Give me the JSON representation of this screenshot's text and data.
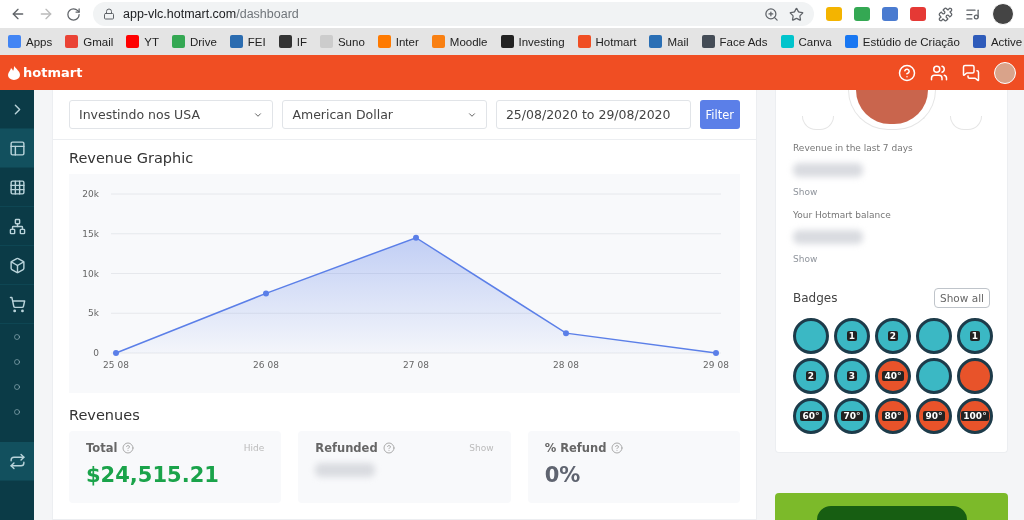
{
  "browser": {
    "url_host": "app-vlc.hotmart.com",
    "url_path": "/dashboard"
  },
  "bookmarks": [
    {
      "label": "Apps",
      "color": "#4285f4"
    },
    {
      "label": "Gmail",
      "color": "#ea4335"
    },
    {
      "label": "YT",
      "color": "#ff0000"
    },
    {
      "label": "Drive",
      "color": "#34a853"
    },
    {
      "label": "FEI",
      "color": "#2b6cb0"
    },
    {
      "label": "IF",
      "color": "#333333"
    },
    {
      "label": "Suno",
      "color": "#cccccc"
    },
    {
      "label": "Inter",
      "color": "#ff7a00"
    },
    {
      "label": "Moodle",
      "color": "#f98012"
    },
    {
      "label": "Investing",
      "color": "#222222"
    },
    {
      "label": "Hotmart",
      "color": "#f04e23"
    },
    {
      "label": "Mail",
      "color": "#2a6fb5"
    },
    {
      "label": "Face Ads",
      "color": "#444c56"
    },
    {
      "label": "Canva",
      "color": "#00c4cc"
    },
    {
      "label": "Estúdio de Criação",
      "color": "#1877f2"
    },
    {
      "label": "Active",
      "color": "#2e5bba"
    }
  ],
  "header": {
    "logo": "hotmart"
  },
  "sidebar": {
    "items": [
      {
        "kind": "chevron",
        "selected": false
      },
      {
        "kind": "dashboard",
        "selected": true
      },
      {
        "kind": "grid",
        "selected": false
      },
      {
        "kind": "network",
        "selected": false
      },
      {
        "kind": "box",
        "selected": false
      },
      {
        "kind": "cart",
        "selected": false
      },
      {
        "kind": "dot",
        "selected": false
      },
      {
        "kind": "dot",
        "selected": false
      },
      {
        "kind": "dot",
        "selected": false
      },
      {
        "kind": "dot",
        "selected": false
      },
      {
        "kind": "sync",
        "selected": true
      }
    ]
  },
  "filters": {
    "product": "Investindo nos USA",
    "currency": "American Dollar",
    "date_range": "25/08/2020 to 29/08/2020",
    "button": "Filter"
  },
  "revenue_graphic": {
    "title": "Revenue Graphic",
    "chart_data": {
      "type": "area",
      "categories": [
        "25 08",
        "26 08",
        "27 08",
        "28 08",
        "29 08"
      ],
      "grid": true,
      "series": [
        {
          "color": "#5b7fe8",
          "values": [
            0,
            7500,
            14500,
            2500,
            0
          ]
        }
      ],
      "ylim": [
        0,
        20000
      ],
      "yticks": [
        {
          "value": 0,
          "label": "0"
        },
        {
          "value": 5000,
          "label": "5k"
        },
        {
          "value": 10000,
          "label": "10k"
        },
        {
          "value": 15000,
          "label": "15k"
        },
        {
          "value": 20000,
          "label": "20k"
        }
      ]
    }
  },
  "revenues": {
    "title": "Revenues",
    "cards": [
      {
        "label": "Total",
        "action": "Hide",
        "hidden": false,
        "value": "$24,515.21",
        "color": "#1aa34a"
      },
      {
        "label": "Refunded",
        "action": "Show",
        "hidden": true
      },
      {
        "label": "% Refund",
        "hidden": false,
        "value": "0%",
        "color": "#5f6470"
      }
    ]
  },
  "right_panel": {
    "stats": [
      {
        "label": "Revenue in the last 7 days",
        "action": "Show",
        "hidden": true
      },
      {
        "label": "Your Hotmart balance",
        "action": "Show",
        "hidden": true
      }
    ],
    "badges": {
      "title": "Badges",
      "button": "Show all",
      "items": [
        {
          "color": "#3bb8c4"
        },
        {
          "color": "#3bb8c4",
          "label": "1"
        },
        {
          "color": "#3bb8c4",
          "label": "2"
        },
        {
          "color": "#3bb8c4"
        },
        {
          "color": "#3bb8c4",
          "label": "1"
        },
        {
          "color": "#3bb8c4",
          "label": "2"
        },
        {
          "color": "#3bb8c4",
          "label": "3"
        },
        {
          "color": "#e8532a",
          "label": "40°"
        },
        {
          "color": "#3bb8c4"
        },
        {
          "color": "#e8532a"
        },
        {
          "color": "#3bb8c4",
          "label": "60°"
        },
        {
          "color": "#3bb8c4",
          "label": "70°"
        },
        {
          "color": "#e8532a",
          "label": "80°"
        },
        {
          "color": "#e8532a",
          "label": "90°"
        },
        {
          "color": "#e8532a",
          "label": "100°"
        }
      ]
    }
  }
}
